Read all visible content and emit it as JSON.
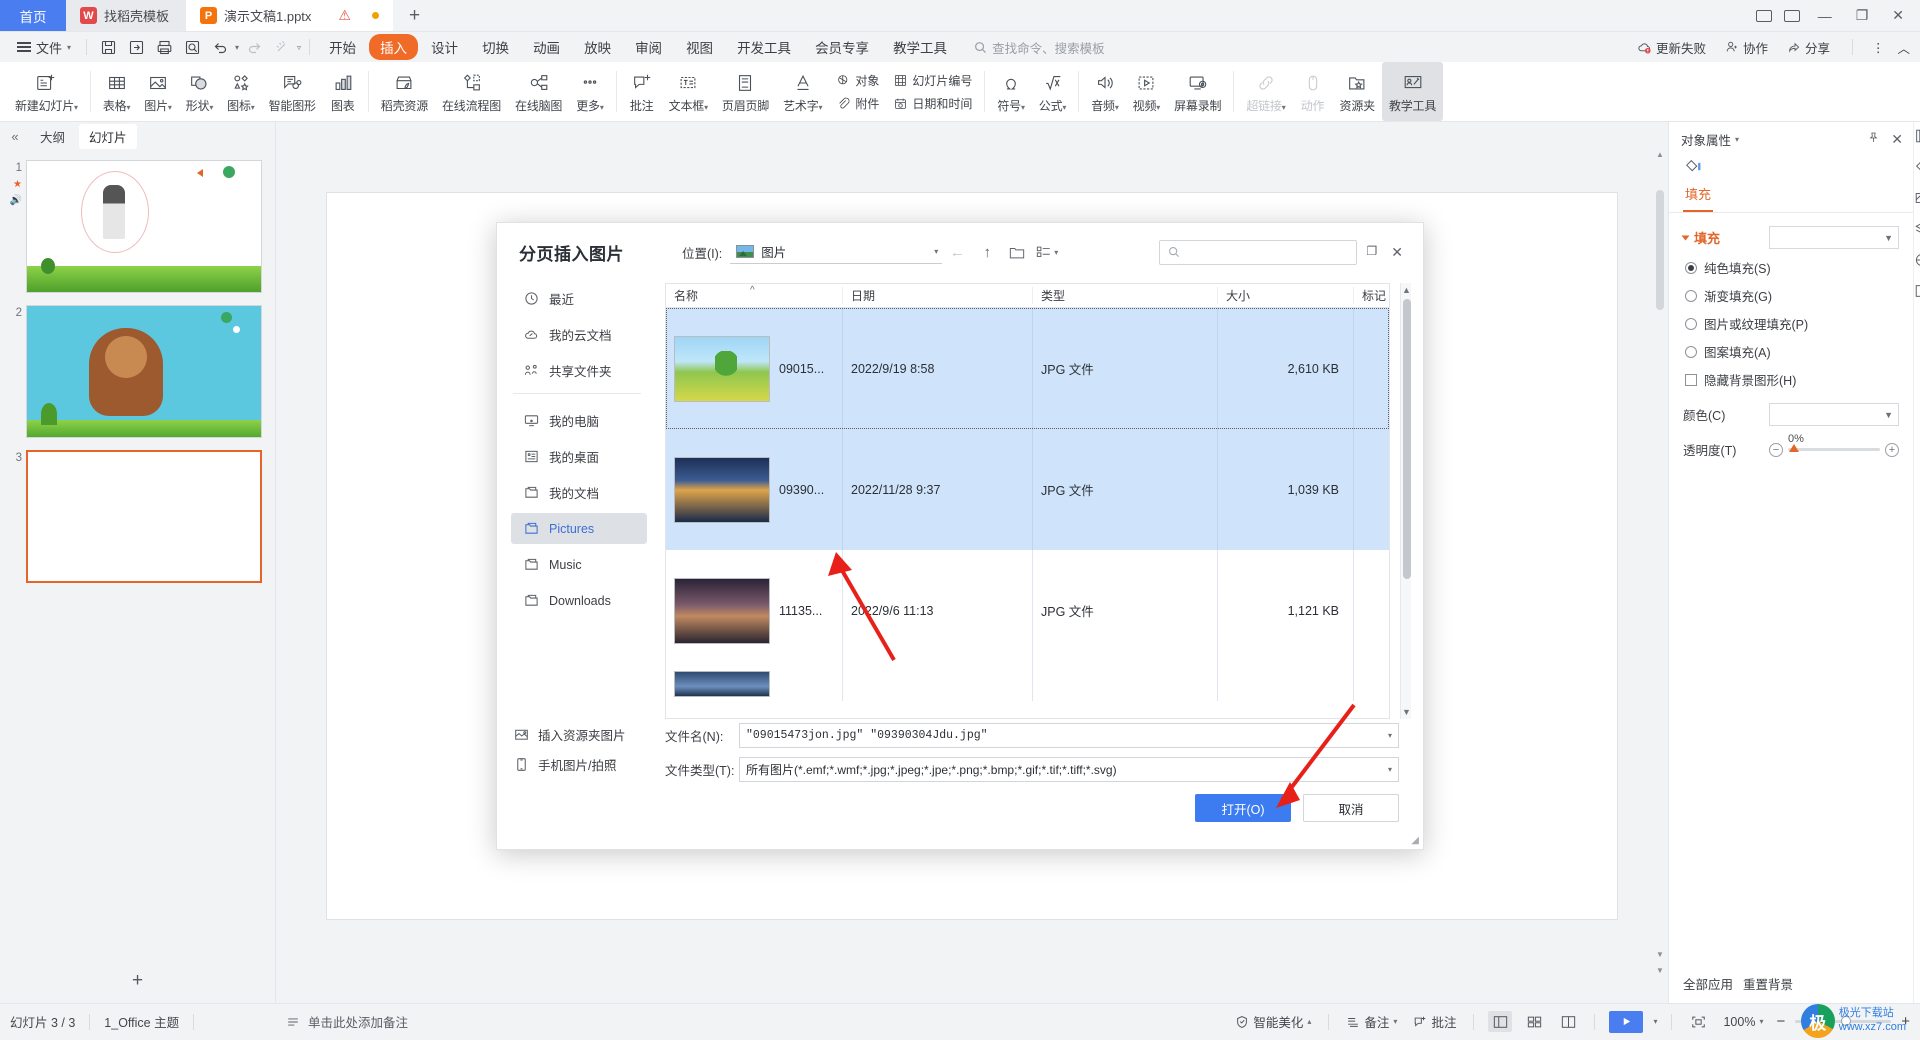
{
  "window": {
    "tabs": [
      {
        "label": "首页",
        "kind": "home"
      },
      {
        "label": "找稻壳模板",
        "kind": "template",
        "icon": "docer-icon"
      },
      {
        "label": "演示文稿1.pptx",
        "kind": "doc",
        "icon": "wpp-icon"
      }
    ],
    "new_tab": "+",
    "controls": {
      "minimize": "—",
      "restore": "❐",
      "close": "✕"
    }
  },
  "menu": {
    "file_label": "文件",
    "quick_icons": [
      "save-icon",
      "save-as-icon",
      "print-icon",
      "print-preview-icon",
      "undo-icon",
      "redo-icon",
      "format-painter-icon",
      "customize-icon"
    ],
    "ribbon_tabs": [
      {
        "label": "开始",
        "active": false
      },
      {
        "label": "插入",
        "active": true
      },
      {
        "label": "设计",
        "active": false
      },
      {
        "label": "切换",
        "active": false
      },
      {
        "label": "动画",
        "active": false
      },
      {
        "label": "放映",
        "active": false
      },
      {
        "label": "审阅",
        "active": false
      },
      {
        "label": "视图",
        "active": false
      },
      {
        "label": "开发工具",
        "active": false
      },
      {
        "label": "会员专享",
        "active": false
      },
      {
        "label": "教学工具",
        "active": false
      }
    ],
    "search_placeholder": "查找命令、搜索模板",
    "right_items": [
      {
        "label": "更新失败",
        "icon": "cloud-error-icon"
      },
      {
        "label": "协作",
        "icon": "collab-icon"
      },
      {
        "label": "分享",
        "icon": "share-icon"
      }
    ]
  },
  "ribbon": {
    "groups": [
      {
        "buttons": [
          {
            "label": "新建幻灯片",
            "icon": "new-slide-icon",
            "caret": true
          }
        ]
      },
      {
        "buttons": [
          {
            "label": "表格",
            "icon": "table-icon",
            "caret": true
          },
          {
            "label": "图片",
            "icon": "picture-icon",
            "caret": true
          },
          {
            "label": "形状",
            "icon": "shapes-icon",
            "caret": true
          },
          {
            "label": "图标",
            "icon": "icons-icon",
            "caret": true
          },
          {
            "label": "智能图形",
            "icon": "smartart-icon",
            "caret": false
          },
          {
            "label": "图表",
            "icon": "chart-icon",
            "caret": false
          }
        ]
      },
      {
        "buttons": [
          {
            "label": "稻壳资源",
            "icon": "docer-resource-icon",
            "caret": false
          },
          {
            "label": "在线流程图",
            "icon": "flowchart-icon",
            "caret": false
          },
          {
            "label": "在线脑图",
            "icon": "mindmap-icon",
            "caret": false
          },
          {
            "label": "更多",
            "icon": "more-icon",
            "caret": true
          }
        ]
      },
      {
        "buttons": [
          {
            "label": "批注",
            "icon": "comment-icon",
            "caret": false
          },
          {
            "label": "文本框",
            "icon": "textbox-icon",
            "caret": true
          },
          {
            "label": "页眉页脚",
            "icon": "header-footer-icon",
            "caret": false
          },
          {
            "label": "艺术字",
            "icon": "wordart-icon",
            "caret": true
          }
        ]
      },
      {
        "stack": [
          {
            "label": "对象",
            "icon": "object-icon"
          },
          {
            "label": "附件",
            "icon": "attachment-icon"
          }
        ]
      },
      {
        "stack": [
          {
            "label": "幻灯片编号",
            "icon": "slide-number-icon"
          },
          {
            "label": "日期和时间",
            "icon": "date-time-icon"
          }
        ]
      },
      {
        "buttons": [
          {
            "label": "符号",
            "icon": "symbol-icon",
            "caret": true
          },
          {
            "label": "公式",
            "icon": "formula-icon",
            "caret": true
          }
        ]
      },
      {
        "buttons": [
          {
            "label": "音频",
            "icon": "audio-icon",
            "caret": true
          },
          {
            "label": "视频",
            "icon": "video-icon",
            "caret": true
          },
          {
            "label": "屏幕录制",
            "icon": "screen-record-icon",
            "caret": false
          }
        ]
      },
      {
        "buttons": [
          {
            "label": "超链接",
            "icon": "hyperlink-icon",
            "caret": true,
            "disabled": true
          },
          {
            "label": "动作",
            "icon": "action-icon",
            "caret": false,
            "disabled": true
          },
          {
            "label": "资源夹",
            "icon": "folder-star-icon",
            "caret": false
          },
          {
            "label": "教学工具",
            "icon": "teaching-tools-icon",
            "caret": false,
            "selected": true
          }
        ]
      }
    ]
  },
  "left_panel": {
    "tabs": [
      {
        "label": "大纲",
        "active": false
      },
      {
        "label": "幻灯片",
        "active": true
      }
    ],
    "slides": [
      {
        "number": "1",
        "selected": false,
        "theme": "light"
      },
      {
        "number": "2",
        "selected": false,
        "theme": "cyan"
      },
      {
        "number": "3",
        "selected": true,
        "theme": "blank"
      }
    ],
    "add_slide": "+"
  },
  "properties_panel": {
    "title": "对象属性",
    "pin_icon": "pin-icon",
    "close_icon": "close-icon",
    "tab": "填充",
    "section_title": "填充",
    "options": [
      {
        "label": "纯色填充(S)",
        "type": "radio",
        "checked": true
      },
      {
        "label": "渐变填充(G)",
        "type": "radio",
        "checked": false
      },
      {
        "label": "图片或纹理填充(P)",
        "type": "radio",
        "checked": false
      },
      {
        "label": "图案填充(A)",
        "type": "radio",
        "checked": false
      },
      {
        "label": "隐藏背景图形(H)",
        "type": "checkbox",
        "checked": false
      }
    ],
    "color_label": "颜色(C)",
    "color_value": "",
    "transparency_label": "透明度(T)",
    "transparency_value": "0%",
    "footer_buttons": [
      "全部应用",
      "重置背景"
    ],
    "rail_icons": [
      "panel-icon",
      "shape-fill-icon",
      "picture-edit-icon",
      "layers-icon",
      "design-icon",
      "animation-icon"
    ]
  },
  "statusbar": {
    "slide_count": "幻灯片 3 / 3",
    "theme": "1_Office 主题",
    "note_hint": "单击此处添加备注",
    "right_items": [
      {
        "label": "智能美化",
        "icon": "beautify-icon"
      },
      {
        "label": "备注",
        "icon": "notes-icon"
      },
      {
        "label": "批注",
        "icon": "comment-icon"
      }
    ],
    "view_buttons": [
      "normal-view-icon",
      "slide-sorter-icon",
      "reading-view-icon"
    ],
    "play_icon": "play-icon",
    "fit_icon": "fit-slide-icon",
    "zoom": "100%",
    "zoom_out": "−",
    "zoom_in": "+"
  },
  "dialog": {
    "title": "分页插入图片",
    "location_label": "位置(I):",
    "location_value": "图片",
    "nav_icons": {
      "back": "back-arrow-icon",
      "up": "up-arrow-icon",
      "new_folder": "new-folder-icon",
      "view": "view-mode-icon"
    },
    "search_placeholder": "",
    "search_icon": "search-icon",
    "win_restore": "restore-icon",
    "win_close": "close-icon",
    "sidebar": [
      {
        "label": "最近",
        "icon": "clock-icon",
        "active": false
      },
      {
        "label": "我的云文档",
        "icon": "cloud-icon",
        "active": false
      },
      {
        "label": "共享文件夹",
        "icon": "share-folder-icon",
        "active": false
      },
      {
        "divider": true
      },
      {
        "label": "我的电脑",
        "icon": "computer-icon",
        "active": false
      },
      {
        "label": "我的桌面",
        "icon": "desktop-icon",
        "active": false
      },
      {
        "label": "我的文档",
        "icon": "documents-icon",
        "active": false
      },
      {
        "label": "Pictures",
        "icon": "folder-icon",
        "active": true
      },
      {
        "label": "Music",
        "icon": "folder-icon",
        "active": false
      },
      {
        "label": "Downloads",
        "icon": "folder-icon",
        "active": false
      }
    ],
    "bottom_links": [
      {
        "label": "插入资源夹图片",
        "icon": "resource-folder-icon"
      },
      {
        "label": "手机图片/拍照",
        "icon": "phone-photo-icon"
      }
    ],
    "columns": [
      "名称",
      "日期",
      "类型",
      "大小",
      "标记"
    ],
    "sort_indicator": "^",
    "files": [
      {
        "name": "09015...",
        "date": "2022/9/19 8:58",
        "type": "JPG 文件",
        "size": "2,610 KB",
        "tag": "",
        "selected": true,
        "focused": true,
        "thumb": "img-field"
      },
      {
        "name": "09390...",
        "date": "2022/11/28 9:37",
        "type": "JPG 文件",
        "size": "1,039 KB",
        "tag": "",
        "selected": true,
        "focused": false,
        "thumb": "img-bridge"
      },
      {
        "name": "11135...",
        "date": "2022/9/6 11:13",
        "type": "JPG 文件",
        "size": "1,121 KB",
        "tag": "",
        "selected": false,
        "focused": false,
        "thumb": "img-sky"
      },
      {
        "name": "",
        "date": "",
        "type": "",
        "size": "",
        "tag": "",
        "selected": false,
        "focused": false,
        "thumb": "img-part"
      }
    ],
    "filename_label": "文件名(N):",
    "filename_value": "\"09015473jon.jpg\" \"09390304Jdu.jpg\"",
    "filetype_label": "文件类型(T):",
    "filetype_value": "所有图片(*.emf;*.wmf;*.jpg;*.jpeg;*.jpe;*.png;*.bmp;*.gif;*.tif;*.tiff;*.svg)",
    "open_button": "打开(O)",
    "cancel_button": "取消"
  },
  "watermark": {
    "line1": "极光下载站",
    "line2": "www.xz7.com"
  },
  "colors": {
    "accent_orange": "#f06b28",
    "accent_blue": "#4a7ef0",
    "selection_blue": "#cfe4fa",
    "panel_orange": "#e2662a",
    "arrow_red": "#e8201a"
  }
}
